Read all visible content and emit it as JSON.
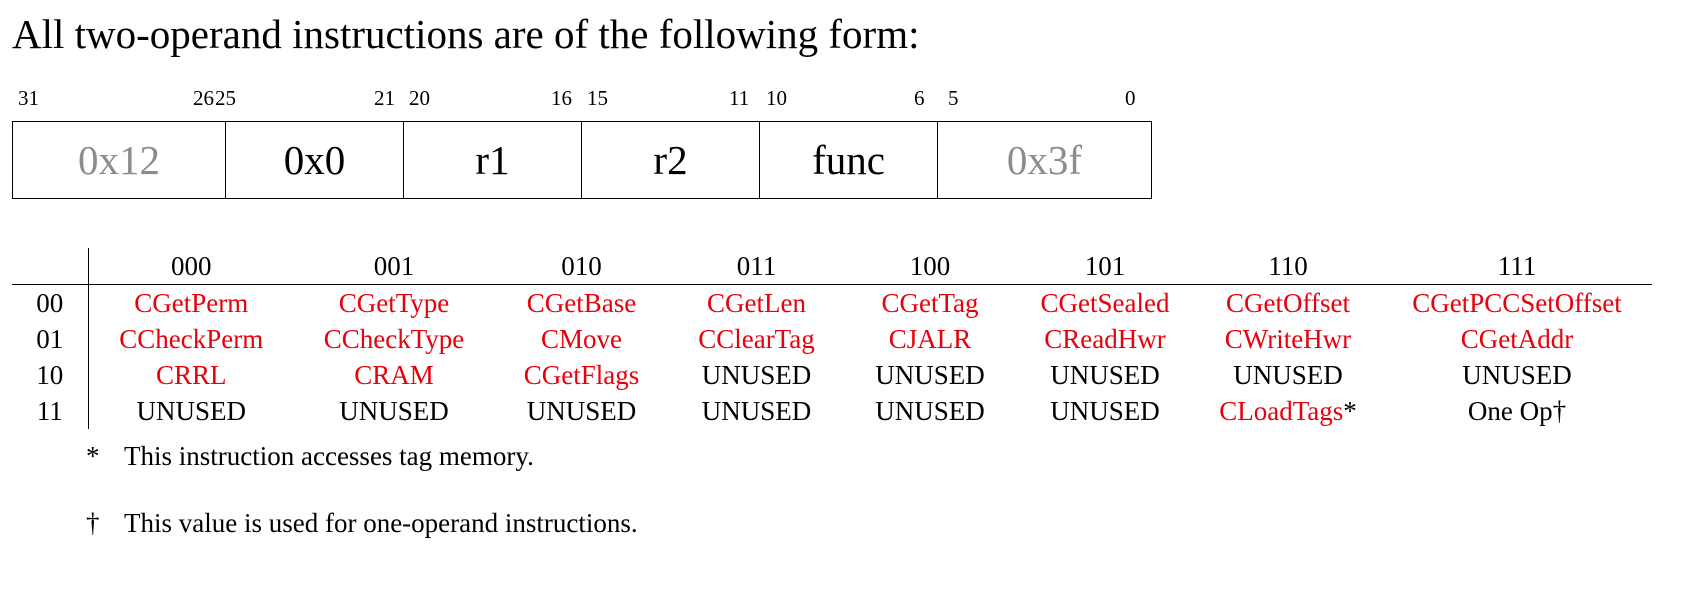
{
  "heading": "All two-operand instructions are of the following form:",
  "bit_numbers": [
    "31",
    "26",
    "25",
    "21",
    "20",
    "16",
    "15",
    "11",
    "10",
    "6",
    "5",
    "0"
  ],
  "encoding_fields": [
    {
      "label": "0x12",
      "muted": true
    },
    {
      "label": "0x0",
      "muted": false
    },
    {
      "label": "r1",
      "muted": false
    },
    {
      "label": "r2",
      "muted": false
    },
    {
      "label": "func",
      "muted": false
    },
    {
      "label": "0x3f",
      "muted": true
    }
  ],
  "table": {
    "col_headers": [
      "000",
      "001",
      "010",
      "011",
      "100",
      "101",
      "110",
      "111"
    ],
    "rows": [
      {
        "label": "00",
        "cells": [
          {
            "text": "CGetPerm",
            "red": true
          },
          {
            "text": "CGetType",
            "red": true
          },
          {
            "text": "CGetBase",
            "red": true
          },
          {
            "text": "CGetLen",
            "red": true
          },
          {
            "text": "CGetTag",
            "red": true
          },
          {
            "text": "CGetSealed",
            "red": true
          },
          {
            "text": "CGetOffset",
            "red": true
          },
          {
            "text": "CGetPCCSetOffset",
            "red": true
          }
        ]
      },
      {
        "label": "01",
        "cells": [
          {
            "text": "CCheckPerm",
            "red": true
          },
          {
            "text": "CCheckType",
            "red": true
          },
          {
            "text": "CMove",
            "red": true
          },
          {
            "text": "CClearTag",
            "red": true
          },
          {
            "text": "CJALR",
            "red": true
          },
          {
            "text": "CReadHwr",
            "red": true
          },
          {
            "text": "CWriteHwr",
            "red": true
          },
          {
            "text": "CGetAddr",
            "red": true
          }
        ]
      },
      {
        "label": "10",
        "cells": [
          {
            "text": "CRRL",
            "red": true
          },
          {
            "text": "CRAM",
            "red": true
          },
          {
            "text": "CGetFlags",
            "red": true
          },
          {
            "text": "UNUSED",
            "red": false
          },
          {
            "text": "UNUSED",
            "red": false
          },
          {
            "text": "UNUSED",
            "red": false
          },
          {
            "text": "UNUSED",
            "red": false
          },
          {
            "text": "UNUSED",
            "red": false
          }
        ]
      },
      {
        "label": "11",
        "cells": [
          {
            "text": "UNUSED",
            "red": false
          },
          {
            "text": "UNUSED",
            "red": false
          },
          {
            "text": "UNUSED",
            "red": false
          },
          {
            "text": "UNUSED",
            "red": false
          },
          {
            "text": "UNUSED",
            "red": false
          },
          {
            "text": "UNUSED",
            "red": false
          },
          {
            "text": "CLoadTags",
            "red": true,
            "suffix": "*"
          },
          {
            "text": "One Op†",
            "red": false
          }
        ]
      }
    ]
  },
  "footnotes": [
    {
      "symbol": "*",
      "text": "This instruction accesses tag memory."
    },
    {
      "symbol": "†",
      "text": "This value is used for one-operand instructions."
    }
  ],
  "colors": {
    "red": "#e8000b",
    "muted": "#8c8c8c"
  }
}
